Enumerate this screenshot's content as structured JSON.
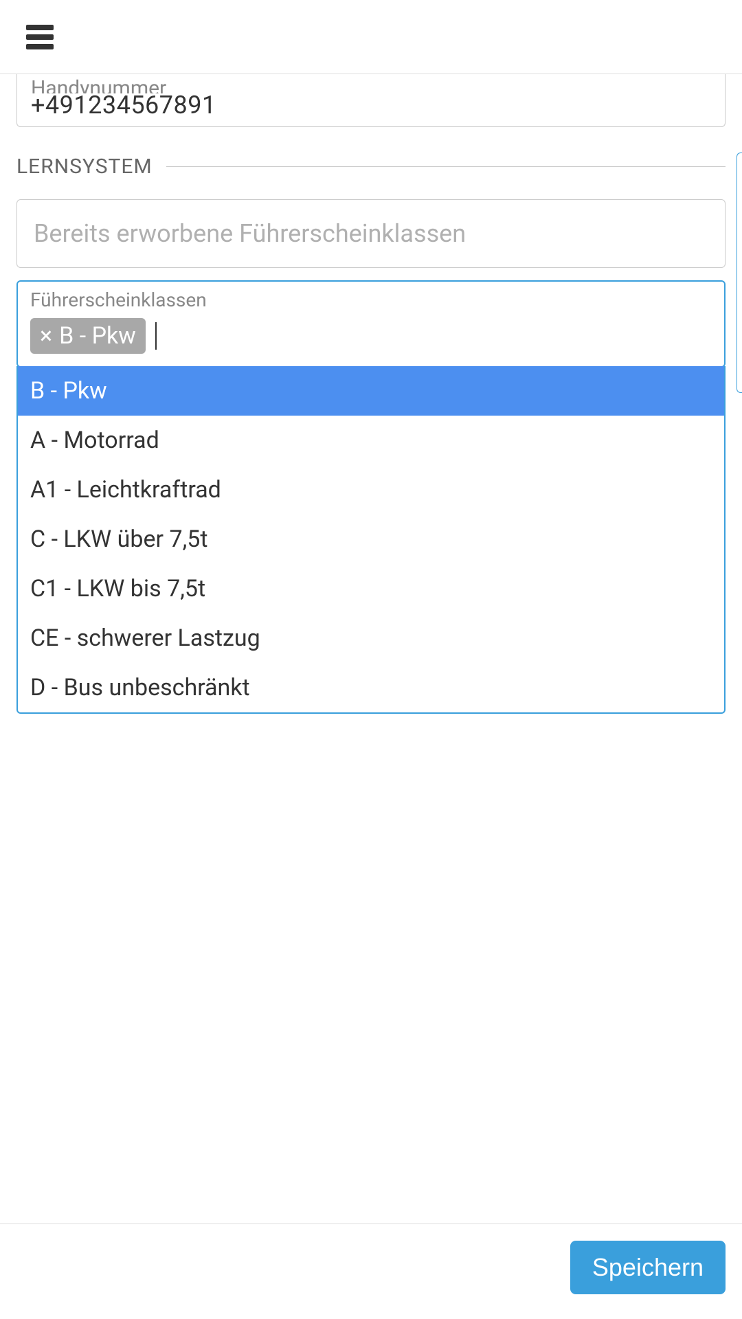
{
  "header": {
    "menu_icon": "hamburger-icon"
  },
  "phone_field": {
    "label": "Handynummer",
    "value": "+491234567891"
  },
  "section": {
    "title": "LERNSYSTEM"
  },
  "acquired_classes": {
    "placeholder": "Bereits erworbene Führerscheinklassen"
  },
  "license_classes": {
    "label": "Führerscheinklassen",
    "selected_chip": "B - Pkw",
    "options": [
      "B - Pkw",
      "A - Motorrad",
      "A1 - Leichtkraftrad",
      "C - LKW über 7,5t",
      "C1 - LKW bis 7,5t",
      "CE - schwerer Lastzug",
      "D - Bus unbeschränkt"
    ]
  },
  "footer": {
    "save_label": "Speichern"
  }
}
